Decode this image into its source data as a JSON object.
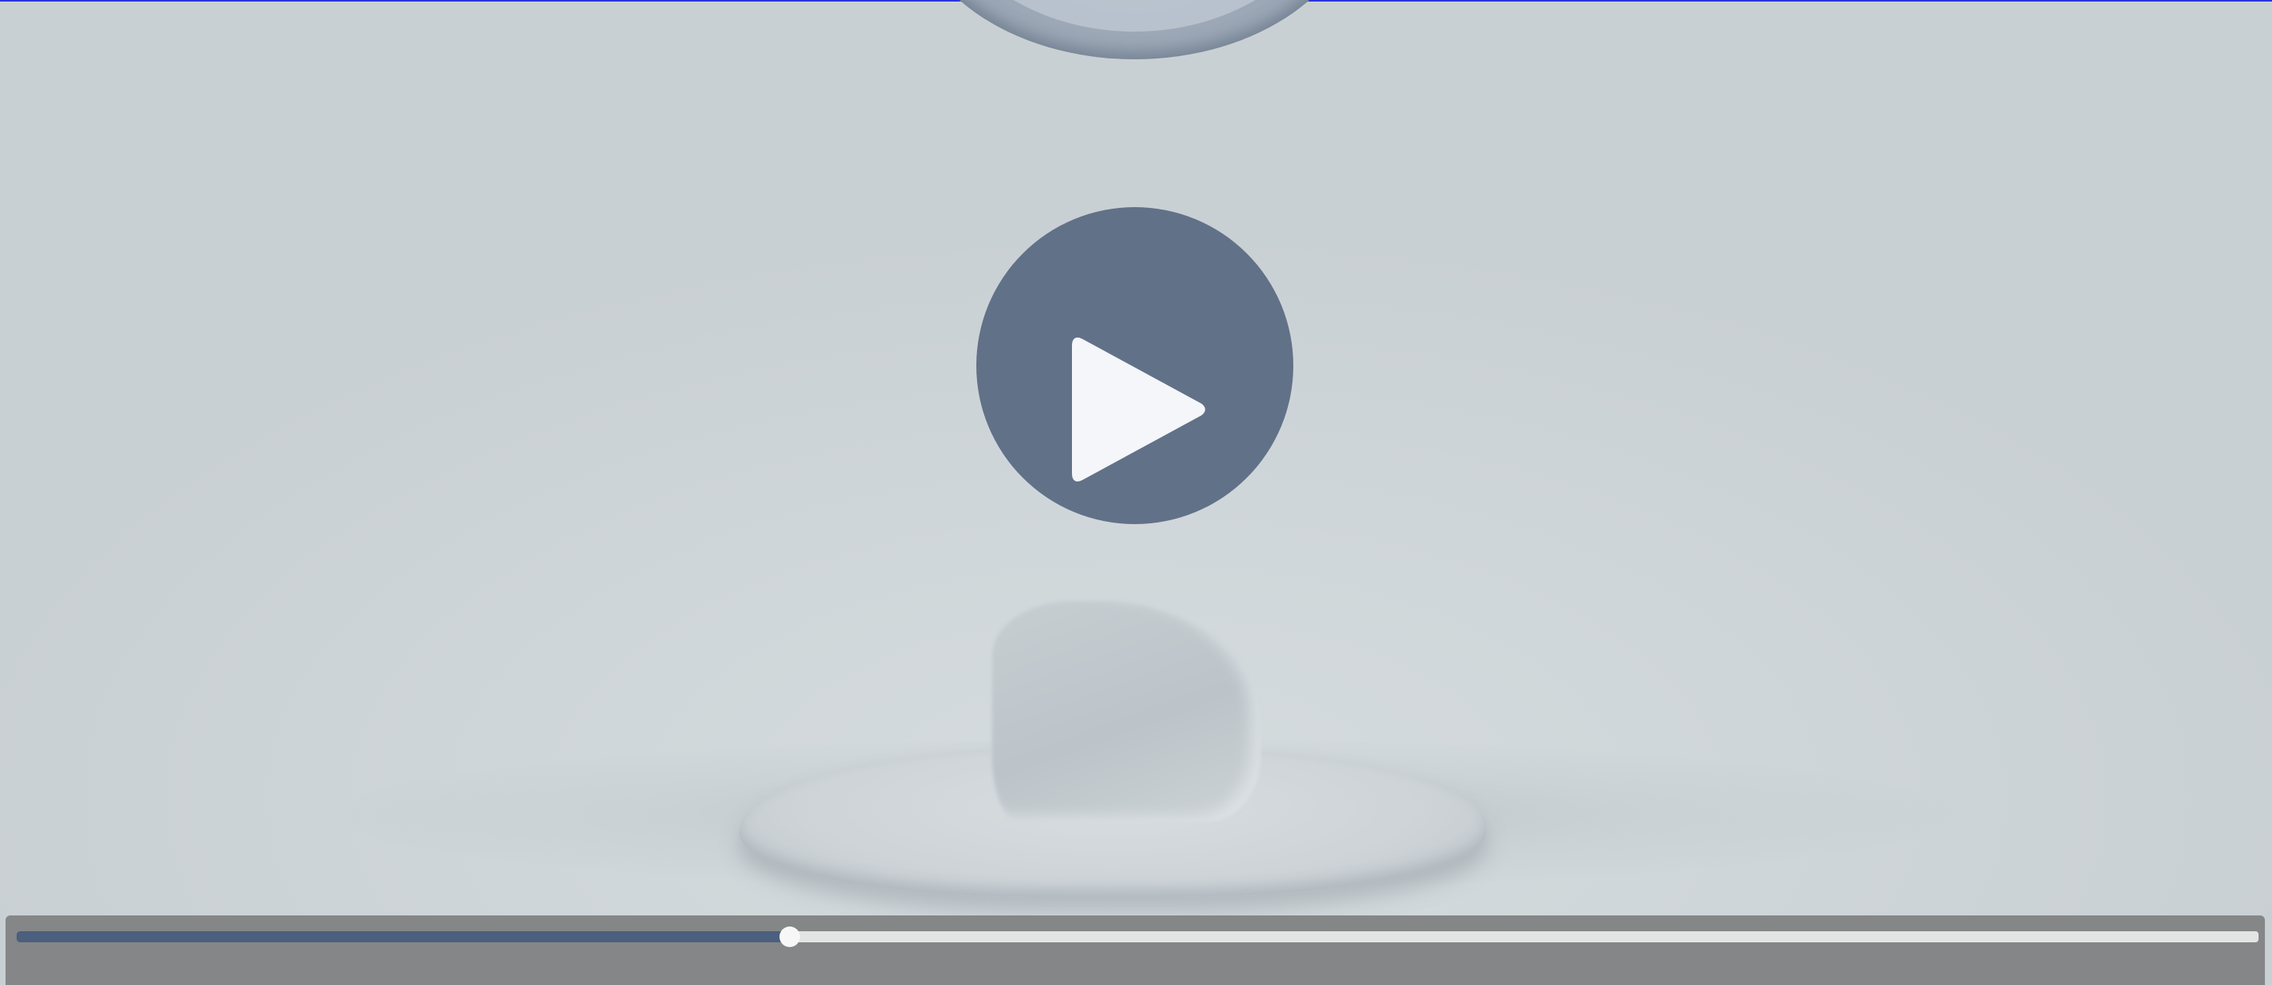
{
  "player": {
    "progress": 0.345,
    "icons": {
      "play": "play-icon"
    }
  },
  "colors": {
    "background": "#c9d0d4",
    "play_button": "#617188",
    "play_glyph": "#f4f6f9",
    "control_bar": "#858687",
    "progress_fill": "#4b5f7e",
    "progress_track": "#e4e4e4",
    "top_line": "#2a34d8"
  }
}
